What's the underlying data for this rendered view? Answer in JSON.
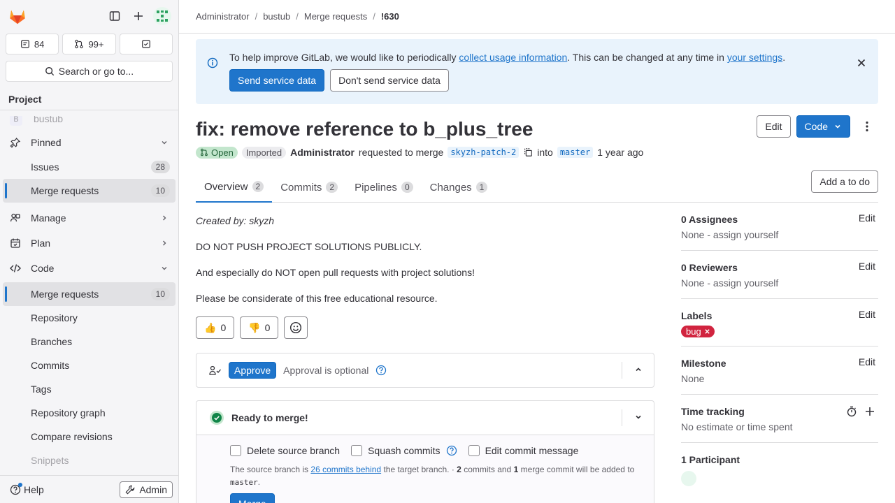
{
  "sidebar": {
    "counters": [
      {
        "label": "84"
      },
      {
        "label": "99+"
      },
      {
        "label": ""
      }
    ],
    "search_label": "Search or go to...",
    "section_title": "Project",
    "faded_project": "bustub",
    "items": [
      {
        "label": "Pinned"
      },
      {
        "label": "Issues",
        "badge": "28"
      },
      {
        "label": "Merge requests",
        "badge": "10"
      },
      {
        "label": "Manage"
      },
      {
        "label": "Plan"
      },
      {
        "label": "Code"
      },
      {
        "label": "Merge requests",
        "badge": "10"
      },
      {
        "label": "Repository"
      },
      {
        "label": "Branches"
      },
      {
        "label": "Commits"
      },
      {
        "label": "Tags"
      },
      {
        "label": "Repository graph"
      },
      {
        "label": "Compare revisions"
      },
      {
        "label": "Snippets"
      }
    ],
    "help_label": "Help",
    "admin_label": "Admin"
  },
  "breadcrumb": [
    "Administrator",
    "bustub",
    "Merge requests",
    "!630"
  ],
  "banner": {
    "text_before": "To help improve GitLab, we would like to periodically ",
    "link1": "collect usage information",
    "text_middle": ". This can be changed at any time in ",
    "link2": "your settings",
    "text_after": ".",
    "send_label": "Send service data",
    "dont_send_label": "Don't send service data"
  },
  "mr": {
    "title": "fix: remove reference to b_plus_tree",
    "edit_label": "Edit",
    "code_label": "Code",
    "status": "Open",
    "imported": "Imported",
    "author": "Administrator",
    "requested_text": "requested to merge",
    "source_branch": "skyzh-patch-2",
    "into_text": "into",
    "target_branch": "master",
    "time_ago": "1 year ago"
  },
  "tabs": [
    {
      "label": "Overview",
      "count": "2"
    },
    {
      "label": "Commits",
      "count": "2"
    },
    {
      "label": "Pipelines",
      "count": "0"
    },
    {
      "label": "Changes",
      "count": "1"
    }
  ],
  "todo_label": "Add a to do",
  "description": {
    "created_by": "Created by: skyzh",
    "p1": "DO NOT PUSH PROJECT SOLUTIONS PUBLICLY.",
    "p2": "And especially do NOT open pull requests with project solutions!",
    "p3": "Please be considerate of this free educational resource."
  },
  "reactions": {
    "thumbs_up": "0",
    "thumbs_down": "0"
  },
  "approval": {
    "button": "Approve",
    "text": "Approval is optional"
  },
  "merge": {
    "title": "Ready to merge!",
    "delete_source": "Delete source branch",
    "squash": "Squash commits",
    "edit_message": "Edit commit message",
    "note_before": "The source branch is ",
    "note_link": "26 commits behind",
    "note_mid": " the target branch. · ",
    "note_commits": "2",
    "note_mid2": " commits and ",
    "note_merge": "1",
    "note_mid3": " merge commit will be added to ",
    "note_target": "master",
    "note_end": ".",
    "button": "Merge"
  },
  "right_sidebar": {
    "assignees_title": "0 Assignees",
    "assignees_value": "None - assign yourself",
    "reviewers_title": "0 Reviewers",
    "reviewers_value": "None - assign yourself",
    "labels_title": "Labels",
    "label_bug": "bug",
    "milestone_title": "Milestone",
    "milestone_value": "None",
    "time_title": "Time tracking",
    "time_value": "No estimate or time spent",
    "participants_title": "1 Participant",
    "edit_label": "Edit"
  },
  "colors": {
    "accent": "#1f75cb",
    "open_badge": "#c3e6cd",
    "bug_label": "#d1243f",
    "banner_bg": "#e9f3fc"
  }
}
